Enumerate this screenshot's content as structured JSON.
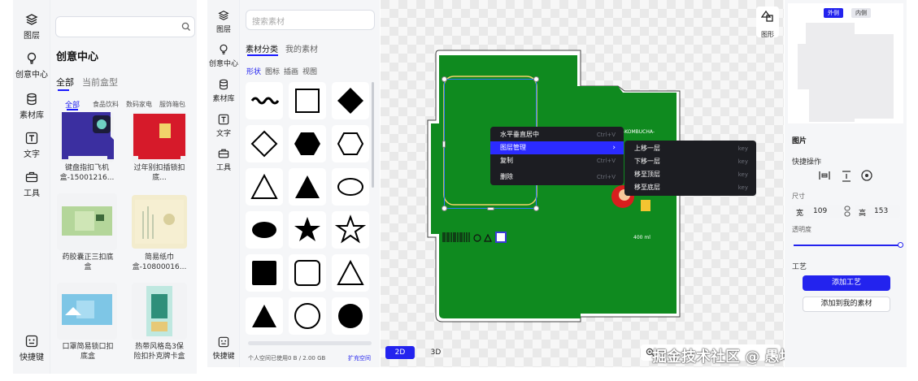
{
  "panel1": {
    "rail": [
      {
        "label": "图层",
        "icon": "layers-icon"
      },
      {
        "label": "创意中心",
        "icon": "bulb-icon"
      },
      {
        "label": "素材库",
        "icon": "database-icon"
      },
      {
        "label": "文字",
        "icon": "text-icon"
      },
      {
        "label": "工具",
        "icon": "toolbox-icon"
      }
    ],
    "shortcut_label": "快捷键",
    "search_placeholder": "",
    "title": "创意中心",
    "tabs": [
      "全部",
      "当前盒型"
    ],
    "categories": [
      "全部",
      "食品饮料",
      "数码家电",
      "服饰箱包"
    ],
    "items": [
      {
        "caption": "键盘指扣飞机\n盒-15001216..."
      },
      {
        "caption": "过年别扣插锁扣\n底..."
      },
      {
        "caption": "药胶囊正三扣底\n盒"
      },
      {
        "caption": "简易纸巾\n盒-10800016..."
      },
      {
        "caption": "口罩简易锁口扣\n底盒"
      },
      {
        "caption": "热带风格岛3保\n险扣扑克牌卡盒"
      }
    ]
  },
  "panel2": {
    "rail": [
      {
        "label": "图层",
        "icon": "layers-icon"
      },
      {
        "label": "创意中心",
        "icon": "bulb-icon"
      },
      {
        "label": "素材库",
        "icon": "database-icon"
      },
      {
        "label": "文字",
        "icon": "text-icon"
      },
      {
        "label": "工具",
        "icon": "toolbox-icon"
      }
    ],
    "shortcut_label": "快捷键",
    "search_placeholder": "搜索素材",
    "tabs": [
      "素材分类",
      "我的素材"
    ],
    "subtabs": [
      "形状",
      "图标",
      "插画",
      "视图"
    ],
    "shapes": [
      "wave",
      "square-outline",
      "diamond-filled",
      "diamond-outline",
      "hexagon-filled",
      "hexagon-outline",
      "triangle-outline",
      "triangle-filled",
      "ellipse-outline",
      "ellipse-filled",
      "star-filled",
      "star-outline",
      "square-filled",
      "rounded-square-outline",
      "triangle-outline",
      "triangle-filled",
      "circle-outline",
      "circle-filled"
    ],
    "storage_text": "个人空间已使用0 B / 2.00 GB",
    "expand_label": "扩充空间"
  },
  "canvas": {
    "shape_tool_label": "图形",
    "mode_2d": "2D",
    "mode_3d": "3D",
    "box_brand": "-KOMBUCHA-",
    "box_volume": "400 ml",
    "context_menu": [
      {
        "label": "水平垂直居中",
        "shortcut": "Ctrl+V"
      },
      {
        "label": "图层管理",
        "shortcut": "›"
      },
      {
        "label": "复制",
        "shortcut": "Ctrl+V"
      },
      {
        "label": "删除",
        "shortcut": "Ctrl+V"
      }
    ],
    "submenu": [
      {
        "label": "上移一层",
        "shortcut": "key"
      },
      {
        "label": "下移一层",
        "shortcut": "key"
      },
      {
        "label": "移至顶层",
        "shortcut": "key"
      },
      {
        "label": "移至底层",
        "shortcut": "key"
      }
    ],
    "watermark": "掘金技术社区 @ 愚坤秦少卫"
  },
  "right": {
    "view_tabs": [
      "外侧",
      "内侧"
    ],
    "section_title": "图片",
    "quick_ops_label": "快捷操作",
    "size_label": "尺寸",
    "width_label": "宽",
    "width_value": "109",
    "height_label": "高",
    "height_value": "153",
    "opacity_label": "透明度",
    "opacity_value": 1.0,
    "craft_label": "工艺",
    "add_craft_button": "添加工艺",
    "add_material_button": "添加到我的素材"
  },
  "colors": {
    "accent": "#2323ee",
    "box_green": "#0f8a1f",
    "menu_bg": "#1c1d22",
    "highlight": "#2b2bff"
  }
}
